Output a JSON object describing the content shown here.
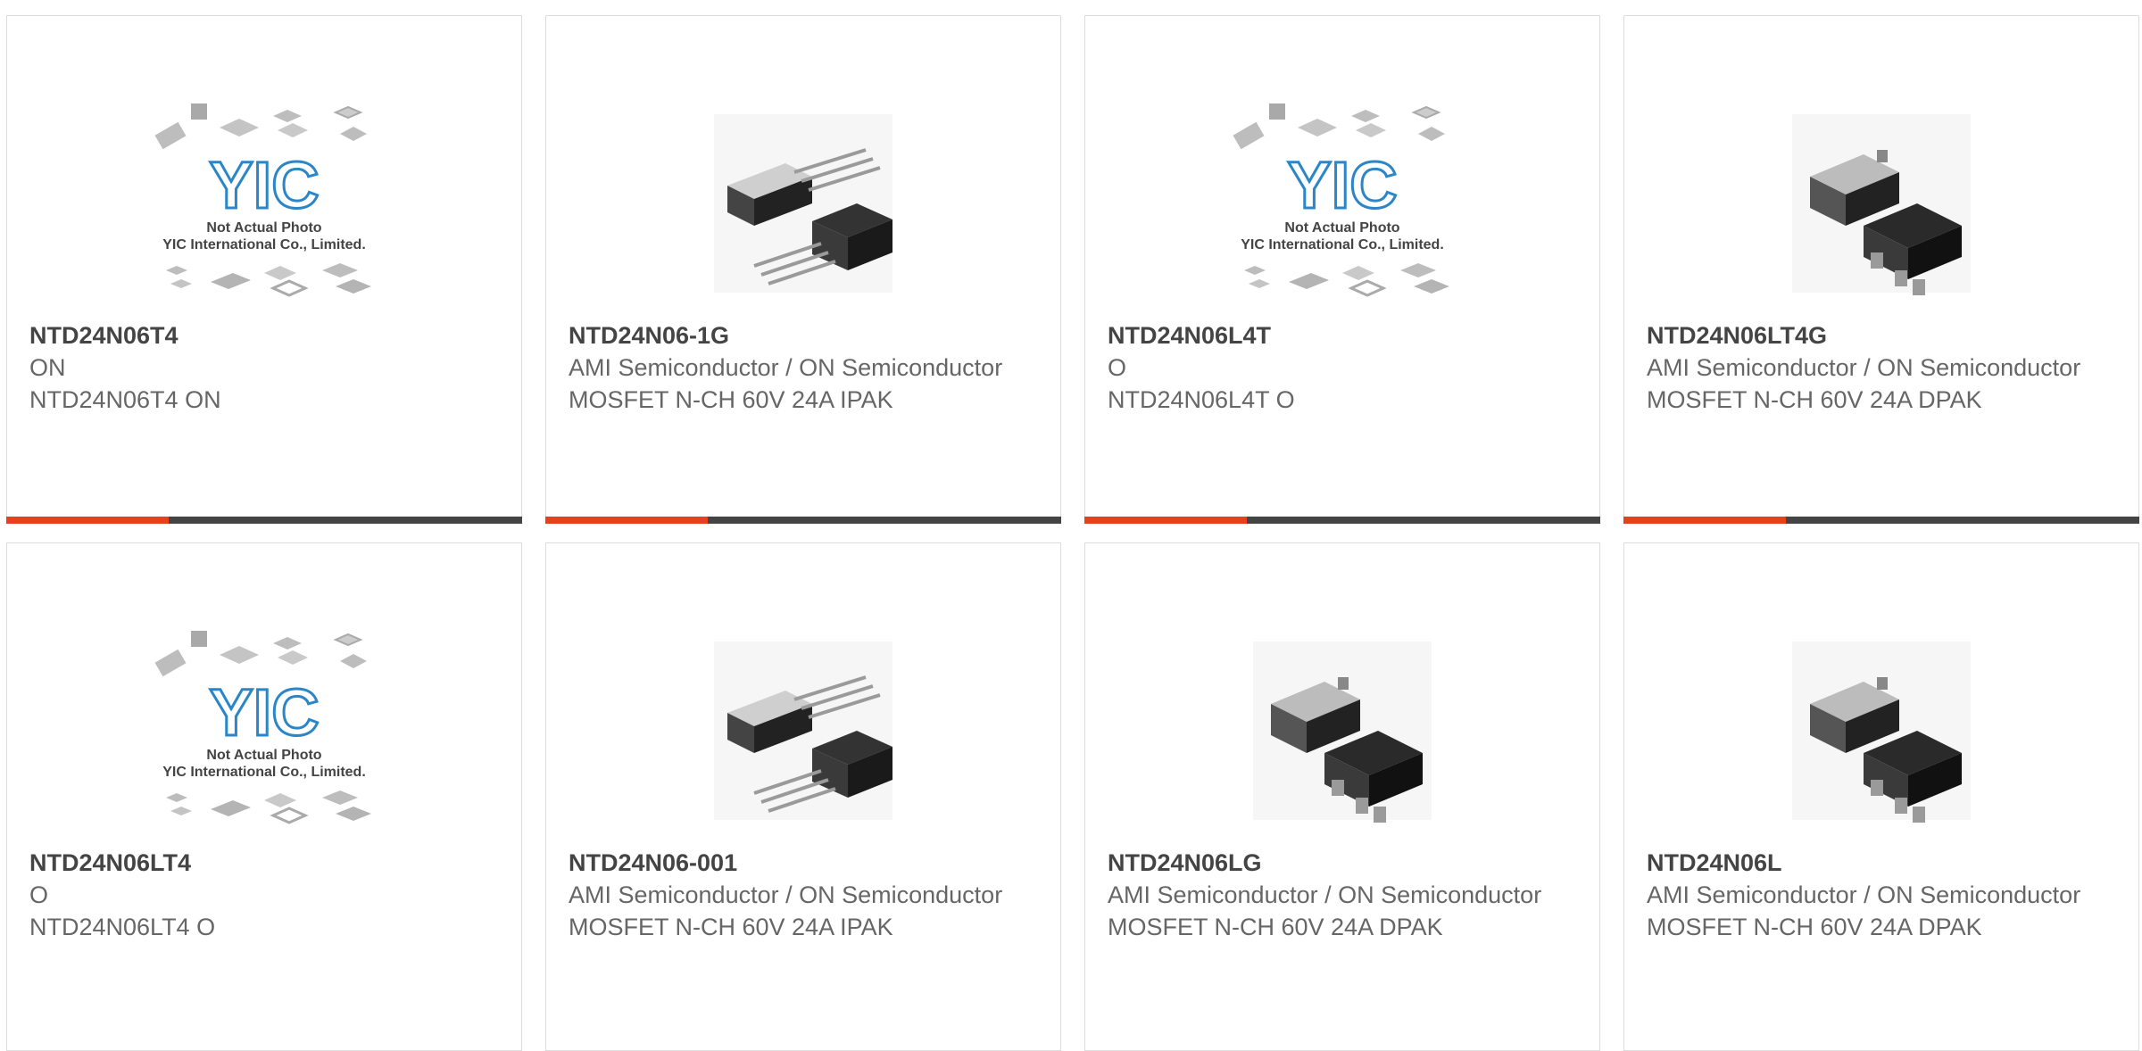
{
  "theme": {
    "accent": "#e8401c",
    "dark": "#444444"
  },
  "products": [
    {
      "title": "NTD24N06T4",
      "manufacturer": "ON",
      "description": "NTD24N06T4 ON",
      "image": "placeholder-not-actual-photo",
      "placeholder": {
        "line1": "Not Actual Photo",
        "line2": "YIC International Co., Limited.",
        "logo": "YIC"
      }
    },
    {
      "title": "NTD24N06-1G",
      "manufacturer": "AMI Semiconductor / ON Semiconductor",
      "description": "MOSFET N-CH 60V 24A IPAK",
      "image": "ipak-package"
    },
    {
      "title": "NTD24N06L4T",
      "manufacturer": "O",
      "description": "NTD24N06L4T O",
      "image": "placeholder-not-actual-photo",
      "placeholder": {
        "line1": "Not Actual Photo",
        "line2": "YIC International Co., Limited.",
        "logo": "YIC"
      }
    },
    {
      "title": "NTD24N06LT4G",
      "manufacturer": "AMI Semiconductor / ON Semiconductor",
      "description": "MOSFET N-CH 60V 24A DPAK",
      "image": "dpak-package"
    },
    {
      "title": "NTD24N06LT4",
      "manufacturer": "O",
      "description": "NTD24N06LT4 O",
      "image": "placeholder-not-actual-photo",
      "placeholder": {
        "line1": "Not Actual Photo",
        "line2": "YIC International Co., Limited.",
        "logo": "YIC"
      }
    },
    {
      "title": "NTD24N06-001",
      "manufacturer": "AMI Semiconductor / ON Semiconductor",
      "description": "MOSFET N-CH 60V 24A IPAK",
      "image": "ipak-package"
    },
    {
      "title": "NTD24N06LG",
      "manufacturer": "AMI Semiconductor / ON Semiconductor",
      "description": "MOSFET N-CH 60V 24A DPAK",
      "image": "dpak-package"
    },
    {
      "title": "NTD24N06L",
      "manufacturer": "AMI Semiconductor / ON Semiconductor",
      "description": "MOSFET N-CH 60V 24A DPAK",
      "image": "dpak-package"
    }
  ]
}
